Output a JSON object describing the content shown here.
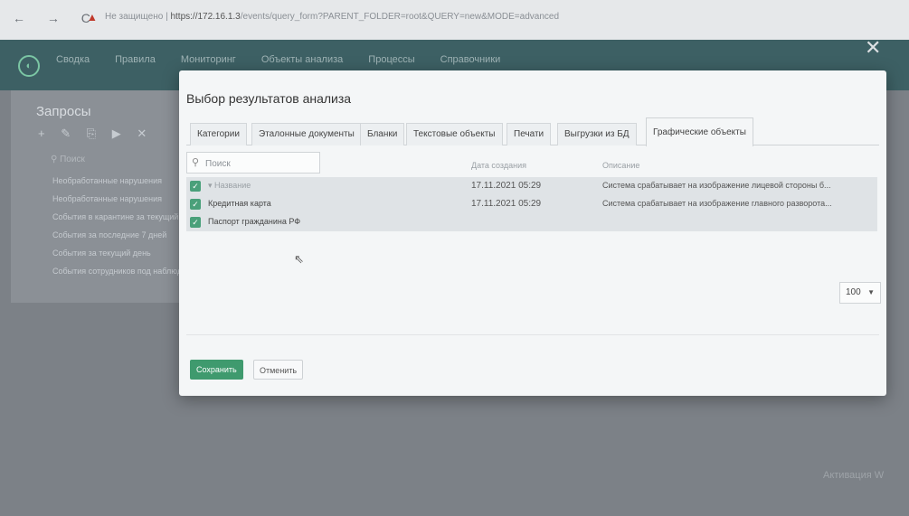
{
  "browser": {
    "security_label": "Не защищено",
    "url_host": "https://172.16.1.3",
    "url_path": "/events/query_form?PARENT_FOLDER=root&QUERY=new&MODE=advanced"
  },
  "app": {
    "nav": [
      "Сводка",
      "Правила",
      "Мониторинг",
      "Объекты анализа",
      "Процессы",
      "Справочники"
    ],
    "left_panel": {
      "title": "Запросы",
      "search_placeholder": "Поиск",
      "items": [
        "Необработанные нарушения",
        "Необработанные нарушения",
        "События в карантине за текущий",
        "События за последние 7 дней",
        "События за текущий день",
        "События сотрудников под наблюдением"
      ]
    }
  },
  "modal": {
    "title": "Выбор результатов анализа",
    "tabs": [
      {
        "label": "Категории"
      },
      {
        "label": "Эталонные документы"
      },
      {
        "label": "Бланки"
      },
      {
        "label": "Текстовые объекты"
      },
      {
        "label": "Печати"
      },
      {
        "label": "Выгрузки из БД"
      },
      {
        "label": "Графические объекты",
        "active": true
      }
    ],
    "search_placeholder": "Поиск",
    "columns": {
      "name": "Название",
      "date": "Дата создания",
      "description": "Описание"
    },
    "rows": [
      {
        "name": "Кредитная карта",
        "date": "17.11.2021 05:29",
        "description": "Система срабатывает на изображение лицевой стороны б...",
        "checked": true
      },
      {
        "name": "Паспорт гражданина РФ",
        "date": "17.11.2021 05:29",
        "description": "Система срабатывает на изображение главного разворота...",
        "checked": true
      }
    ],
    "page_size": "100",
    "buttons": {
      "save": "Сохранить",
      "cancel": "Отменить"
    }
  },
  "watermark": "Активация W"
}
